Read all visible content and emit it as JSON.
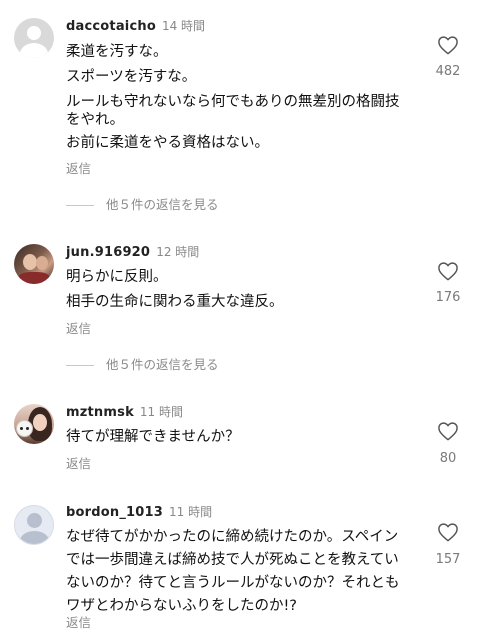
{
  "comments": [
    {
      "username": "daccotaicho",
      "time": "14 時間",
      "lines": [
        "柔道を汚すな。",
        "スポーツを汚すな。",
        "ルールも守れないなら何でもありの無差別の格闘技",
        "をやれ。",
        "お前に柔道をやる資格はない。"
      ],
      "reply_label": "返信",
      "likes": "482",
      "more_replies": "他５件の返信を見る"
    },
    {
      "username": "jun.916920",
      "time": "12 時間",
      "lines": [
        "明らかに反則。",
        "相手の生命に関わる重大な違反。"
      ],
      "reply_label": "返信",
      "likes": "176",
      "more_replies": "他５件の返信を見る"
    },
    {
      "username": "mztnmsk",
      "time": "11 時間",
      "lines": [
        "待てが理解できませんか？"
      ],
      "reply_label": "返信",
      "likes": "80"
    },
    {
      "username": "bordon_1013",
      "time": "11 時間",
      "lines": [
        "なぜ待てがかかったのに締め続けたのか。スペイン",
        "では一歩間違えば締め技で人が死ぬことを教えてい",
        "ないのか？待てと言うルールがないのか？それとも",
        "ワザとわからないふりをしたのか!?"
      ],
      "reply_label": "返信",
      "likes": "157"
    }
  ]
}
